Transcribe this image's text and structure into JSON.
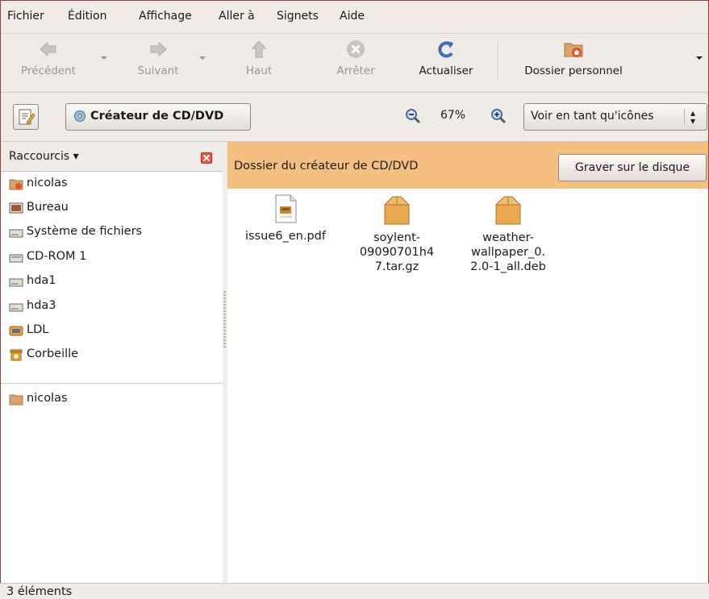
{
  "menu": [
    {
      "label": "Fichier"
    },
    {
      "label": "Édition"
    },
    {
      "label": "Affichage"
    },
    {
      "label": "Aller à"
    },
    {
      "label": "Signets"
    },
    {
      "label": "Aide"
    }
  ],
  "toolbar": {
    "back": "Précédent",
    "forward": "Suivant",
    "up": "Haut",
    "stop": "Arrêter",
    "reload": "Actualiser",
    "home": "Dossier personnel"
  },
  "location": {
    "path_button": "Créateur de CD/DVD",
    "zoom": "67%",
    "view_mode": "Voir en tant qu'icônes"
  },
  "sidebar": {
    "title": "Raccourcis",
    "items": [
      {
        "label": "nicolas",
        "icon": "home-folder-icon"
      },
      {
        "label": "Bureau",
        "icon": "desktop-icon"
      },
      {
        "label": "Système de fichiers",
        "icon": "drive-icon"
      },
      {
        "label": "CD-ROM 1",
        "icon": "cdrom-icon"
      },
      {
        "label": "hda1",
        "icon": "drive-icon"
      },
      {
        "label": "hda3",
        "icon": "drive-icon"
      },
      {
        "label": "LDL",
        "icon": "network-icon"
      },
      {
        "label": "Corbeille",
        "icon": "trash-icon"
      }
    ],
    "bookmarks": [
      {
        "label": "nicolas",
        "icon": "folder-icon"
      }
    ]
  },
  "main": {
    "banner_text": "Dossier du créateur de CD/DVD",
    "burn_button": "Graver sur le disque",
    "files": [
      {
        "name": "issue6_en.pdf",
        "icon": "pdf-file-icon"
      },
      {
        "name": "soylent-09090701h47.tar.gz",
        "display": "soylent-\n09090701h4\n7.tar.gz",
        "icon": "package-icon"
      },
      {
        "name": "weather-wallpaper_0.2.0-1_all.deb",
        "display": "weather-\nwallpaper_0.\n2.0-1_all.deb",
        "icon": "package-icon"
      }
    ]
  },
  "status": "3 éléments",
  "colors": {
    "banner": "#f5bf7f",
    "window_bg": "#efebe7",
    "accent_blue": "#3d6fb8",
    "package_orange": "#e9a74f"
  }
}
